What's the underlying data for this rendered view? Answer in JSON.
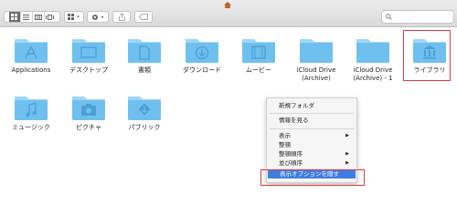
{
  "window": {
    "title": ""
  },
  "toolbar": {
    "view_modes": [
      "icon-view",
      "list-view",
      "column-view",
      "cover-flow-view"
    ],
    "arrange_icon": "grid-icon",
    "action_icon": "gear-icon",
    "share_icon": "share-icon",
    "tag_icon": "tag-icon",
    "search_placeholder": ""
  },
  "folders": [
    {
      "label": "Applications",
      "icon": "applications-icon"
    },
    {
      "label": "デスクトップ",
      "icon": "desktop-icon"
    },
    {
      "label": "書類",
      "icon": "documents-icon"
    },
    {
      "label": "ダウンロード",
      "icon": "download-icon"
    },
    {
      "label": "ムービー",
      "icon": "movies-icon"
    },
    {
      "label": "iCloud Drive\n(Archive)",
      "icon": "generic-folder"
    },
    {
      "label": "iCloud Drive\n(Archive) - 1",
      "icon": "generic-folder"
    },
    {
      "label": "ライブラリ",
      "icon": "library-icon"
    },
    {
      "label": "ミュージック",
      "icon": "music-icon"
    },
    {
      "label": "ピクチャ",
      "icon": "camera-icon"
    },
    {
      "label": "パブリック",
      "icon": "public-icon"
    }
  ],
  "context_menu": {
    "new_folder": "新規フォルダ",
    "get_info": "情報を見る",
    "view": "表示",
    "clean_up": "整頓",
    "clean_up_by": "整頓順序",
    "sort_by": "並び順序",
    "hide_view_options": "表示オプションを隠す"
  },
  "colors": {
    "folder": "#6fc0ef",
    "folder_tab": "#9dd6f6",
    "highlight": "#e0393e",
    "menu_selection": "#3f7de0"
  }
}
